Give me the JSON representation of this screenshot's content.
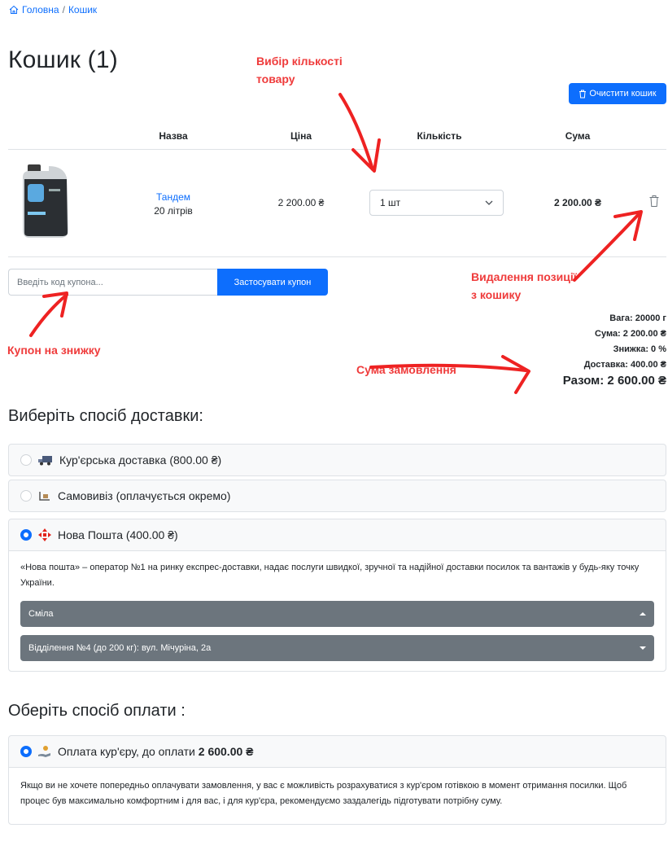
{
  "breadcrumb": {
    "home": "Головна",
    "separator": "/",
    "current": "Кошик"
  },
  "page_title": "Кошик (1)",
  "clear_cart_label": "Очистити кошик",
  "table": {
    "headers": {
      "name": "Назва",
      "price": "Ціна",
      "quantity": "Кількість",
      "sum": "Сума"
    },
    "items": [
      {
        "name_link": "Тандем",
        "volume": "20 літрів",
        "price": "2 200.00 ₴",
        "quantity": "1 шт",
        "sum": "2 200.00 ₴"
      }
    ]
  },
  "coupon": {
    "placeholder": "Введіть код купона...",
    "button": "Застосувати купон"
  },
  "summary": {
    "weight": "Вага: 20000 г",
    "sum": "Сума: 2 200.00 ₴",
    "discount": "Знижка: 0 %",
    "delivery": "Доставка: 400.00 ₴",
    "total": "Разом: 2 600.00 ₴"
  },
  "annotations": {
    "quantity": "Вибір кількості товару",
    "delete": "Видалення позиції з кошику",
    "coupon": "Купон на знижку",
    "order_sum": "Сума замовлення"
  },
  "delivery": {
    "title": "Виберіть спосіб доставки:",
    "options": [
      {
        "label": "Кур'єрська доставка (800.00 ₴)",
        "selected": false,
        "icon": "truck-icon"
      },
      {
        "label": "Самовивіз (оплачується окремо)",
        "selected": false,
        "icon": "pickup-icon"
      },
      {
        "label": "Нова Пошта (400.00 ₴)",
        "selected": true,
        "icon": "nova-poshta-icon"
      }
    ],
    "np_description": "«Нова пошта» – оператор №1 на ринку експрес-доставки, надає послуги швидкої, зручної та надійної доставки посилок та вантажів у будь-яку точку України.",
    "city": "Сміла",
    "branch": "Відділення №4 (до 200 кг): вул. Мічуріна, 2а"
  },
  "payment": {
    "title": "Оберіть спосіб оплати :",
    "option_label": "Оплата кур'єру, до оплати ",
    "option_amount": "2 600.00 ₴",
    "description": "Якщо ви не хочете попередньо оплачувати замовлення, у вас є можливість розрахуватися з кур'єром готівкою в момент отримання посилки. Щоб процес був максимально комфортним і для вас, і для кур'єра, рекомендуємо заздалегідь підготувати потрібну суму."
  },
  "colors": {
    "primary": "#0d6efd",
    "annotation": "#ef3b3b",
    "dropdown": "#6c757d",
    "nova_poshta": "#e2231a"
  }
}
